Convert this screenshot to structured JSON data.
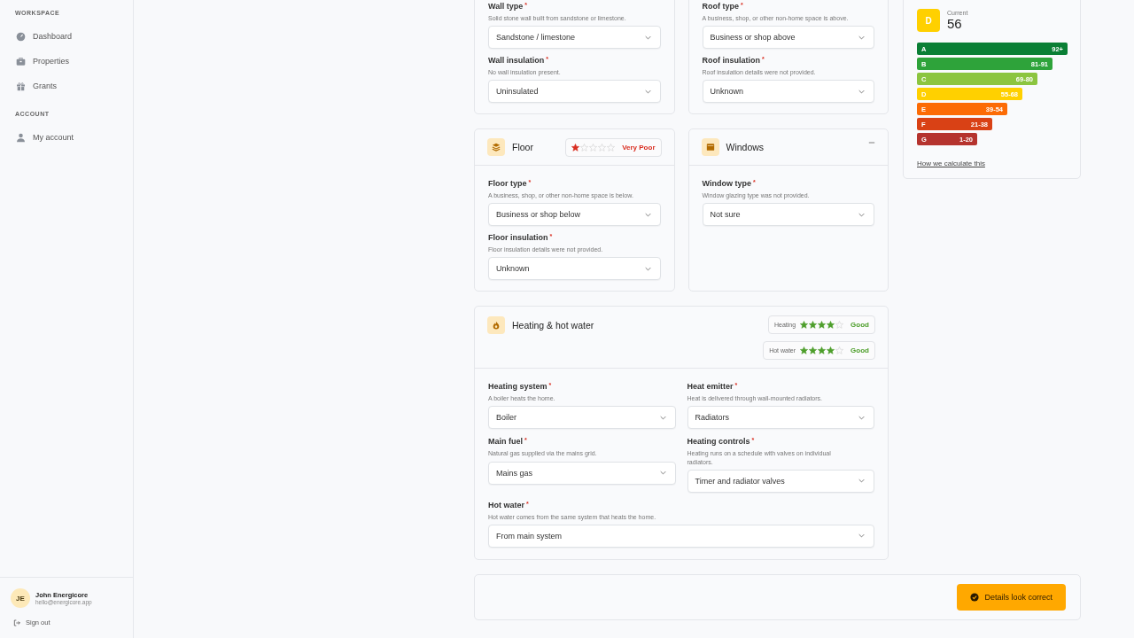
{
  "sidebar": {
    "sections": [
      {
        "heading": "WORKSPACE",
        "items": [
          {
            "label": "Dashboard"
          },
          {
            "label": "Properties"
          },
          {
            "label": "Grants"
          }
        ]
      },
      {
        "heading": "ACCOUNT",
        "items": [
          {
            "label": "My account"
          }
        ]
      }
    ],
    "user": {
      "initials": "JE",
      "name": "John Energicore",
      "email": "hello@energicore.app"
    },
    "sign_out": "Sign out"
  },
  "top_cards": [
    {
      "fields": [
        {
          "label": "Wall type",
          "required_mark": "*",
          "hint": "Solid stone wall built from sandstone or limestone.",
          "value": "Sandstone / limestone"
        },
        {
          "label": "Wall insulation",
          "required_mark": "*",
          "hint": "No wall insulation present.",
          "value": "Uninsulated"
        }
      ]
    },
    {
      "fields": [
        {
          "label": "Roof type",
          "required_mark": "*",
          "hint": "A business, shop, or other non-home space is above.",
          "value": "Business or shop above"
        },
        {
          "label": "Roof insulation",
          "required_mark": "*",
          "hint": "Roof insulation details were not provided.",
          "value": "Unknown"
        }
      ]
    }
  ],
  "mid_cards": [
    {
      "title": "Floor",
      "ratings": [
        {
          "stars": 1,
          "verdict": "Very Poor",
          "color": "#d92d20"
        }
      ],
      "fields": [
        {
          "label": "Floor type",
          "required_mark": "*",
          "hint": "A business, shop, or other non-home space is below.",
          "value": "Business or shop below"
        },
        {
          "label": "Floor insulation",
          "required_mark": "*",
          "hint": "Floor insulation details were not provided.",
          "value": "Unknown"
        }
      ]
    },
    {
      "title": "Windows",
      "collapsed": false,
      "fields": [
        {
          "label": "Window type",
          "required_mark": "*",
          "hint": "Window glazing type was not provided.",
          "value": "Not sure"
        }
      ]
    }
  ],
  "heating": {
    "title": "Heating & hot water",
    "ratings": [
      {
        "label": "Heating",
        "stars": 4,
        "verdict": "Good",
        "color": "#4d9e2a"
      },
      {
        "label": "Hot water",
        "stars": 4,
        "verdict": "Good",
        "color": "#4d9e2a"
      }
    ],
    "fields": [
      {
        "label": "Heating system",
        "required_mark": "*",
        "hint": "A boiler heats the home.",
        "value": "Boiler"
      },
      {
        "label": "Heat emitter",
        "required_mark": "*",
        "hint": "Heat is delivered through wall-mounted radiators.",
        "value": "Radiators"
      },
      {
        "label": "Main fuel",
        "required_mark": "*",
        "hint": "Natural gas supplied via the mains grid.",
        "value": "Mains gas"
      },
      {
        "label": "Heating controls",
        "required_mark": "*",
        "hint": "Heating runs on a schedule with valves on individual radiators.",
        "value": "Timer and radiator valves"
      },
      {
        "label": "Hot water",
        "required_mark": "*",
        "hint": "Hot water comes from the same system that heats the home.",
        "value": "From main system"
      }
    ]
  },
  "confirm_button": "Details look correct",
  "rating_panel": {
    "band": "D",
    "caption": "Current",
    "score": "56",
    "bands": [
      {
        "letter": "A",
        "range": "92+",
        "color": "#0a7f35"
      },
      {
        "letter": "B",
        "range": "81-91",
        "color": "#2ea33a"
      },
      {
        "letter": "C",
        "range": "69-80",
        "color": "#8cc540"
      },
      {
        "letter": "D",
        "range": "55-68",
        "color": "#ffd000"
      },
      {
        "letter": "E",
        "range": "39-54",
        "color": "#fc6b05"
      },
      {
        "letter": "F",
        "range": "21-38",
        "color": "#d94115"
      },
      {
        "letter": "G",
        "range": "1-20",
        "color": "#b5332e"
      }
    ],
    "link": "How we calculate this"
  }
}
